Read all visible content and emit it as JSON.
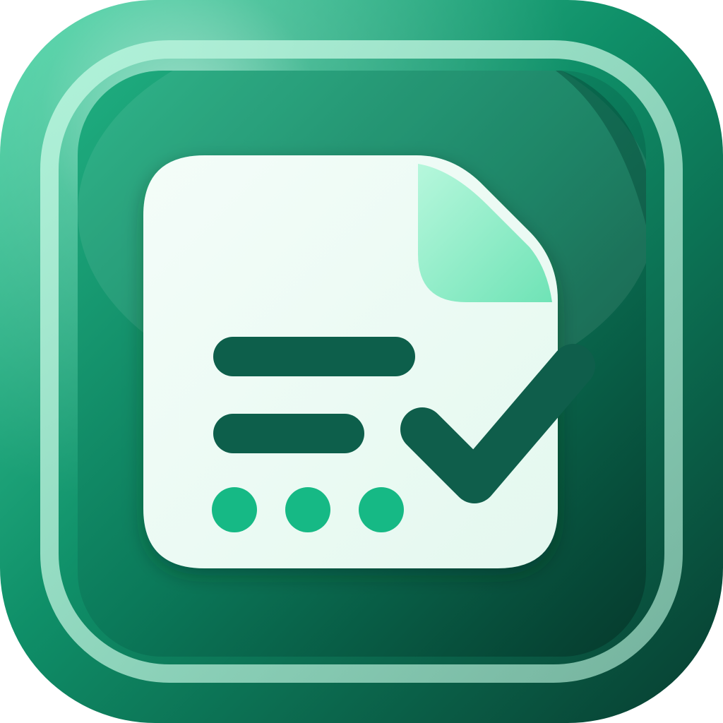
{
  "icon": {
    "name": "document-checklist-app-icon",
    "colors": {
      "tile_light": "#3fd3a0",
      "tile_mid": "#0f8f68",
      "tile_dark": "#073d30",
      "border_glow": "#a6f0d2",
      "page_white": "#f4fdf9",
      "page_tint": "#e4f8ef",
      "fold_light": "#b6f7dc",
      "fold_dark": "#6fe3b6",
      "ink_dark": "#0f5e4b",
      "dot_green": "#18b985"
    },
    "elements": {
      "document": "document-icon",
      "checkmark": "checkmark-icon",
      "lines": 2,
      "dots": 3
    }
  }
}
